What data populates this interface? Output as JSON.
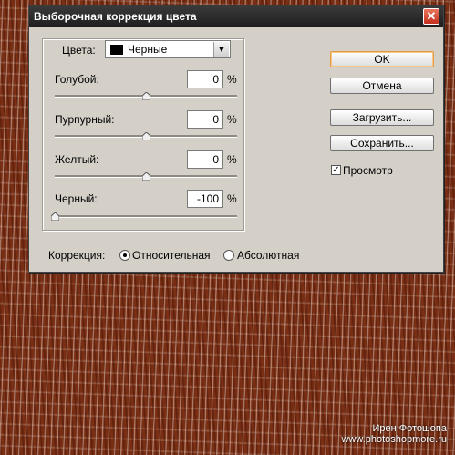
{
  "dialog": {
    "title": "Выборочная коррекция цвета",
    "close_glyph": "✕"
  },
  "colors": {
    "label": "Цвета:",
    "selected": "Черные",
    "swatch_color": "#000000"
  },
  "sliders": [
    {
      "label": "Голубой:",
      "value": "0",
      "unit": "%",
      "position": 0.5
    },
    {
      "label": "Пурпурный:",
      "value": "0",
      "unit": "%",
      "position": 0.5
    },
    {
      "label": "Желтый:",
      "value": "0",
      "unit": "%",
      "position": 0.5
    },
    {
      "label": "Черный:",
      "value": "-100",
      "unit": "%",
      "position": 0.0
    }
  ],
  "buttons": {
    "ok": "OK",
    "cancel": "Отмена",
    "load": "Загрузить...",
    "save": "Сохранить..."
  },
  "preview": {
    "label": "Просмотр",
    "checked": true,
    "check_glyph": "✓"
  },
  "correction": {
    "label": "Коррекция:",
    "relative": "Относительная",
    "absolute": "Абсолютная",
    "selected": "relative"
  },
  "watermark": {
    "line1": "Ирен Фотошопа",
    "line2": "www.photoshopmore.ru"
  },
  "theme": {
    "dialog_bg": "#d4d0c8",
    "title_bg": "#2a2a2a",
    "close_bg": "#c2301c",
    "default_button_border": "#e59a3d"
  }
}
